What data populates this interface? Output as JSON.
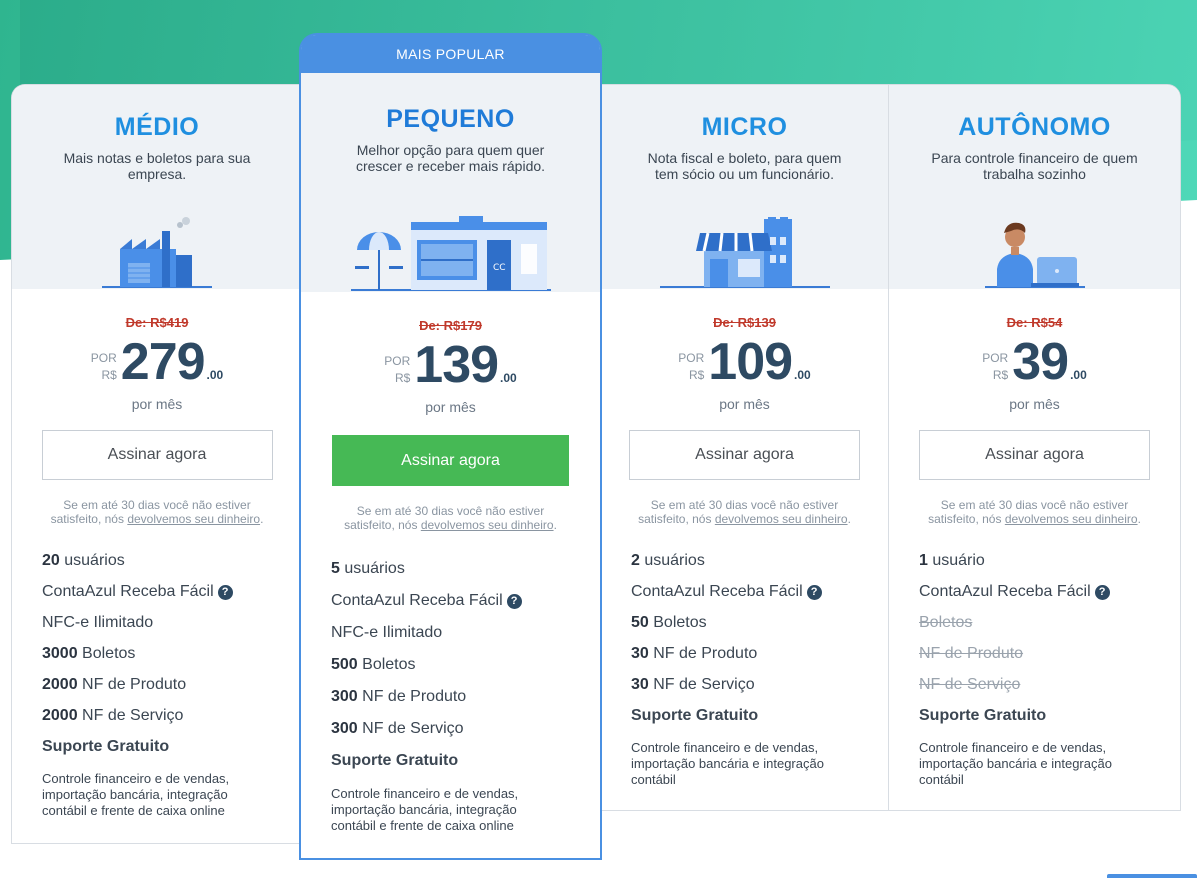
{
  "plans": [
    {
      "name": "MÉDIO",
      "desc": "Mais notas e boletos para sua empresa.",
      "old_price": "De: R$419",
      "por": "POR",
      "currency": "R$",
      "price": "279",
      "cents": ".00",
      "per_month": "por mês",
      "button": "Assinar agora",
      "guarantee_text": "Se em até 30 dias você não estiver satisfeito, nós",
      "guarantee_link": "devolvemos seu dinheiro",
      "guarantee_end": ".",
      "features": [
        {
          "num": "20",
          "text": " usuários"
        },
        {
          "num": "",
          "text": "ContaAzul Receba Fácil"
        },
        {
          "num": "",
          "text": "NFC-e Ilimitado"
        },
        {
          "num": "3000",
          "text": " Boletos"
        },
        {
          "num": "2000",
          "text": " NF de Produto"
        },
        {
          "num": "2000",
          "text": " NF de Serviço"
        },
        {
          "num": "",
          "text": "Suporte Gratuito"
        }
      ],
      "extra": "Controle financeiro e de vendas, importação bancária, integração contábil e frente de caixa online"
    },
    {
      "badge": "MAIS POPULAR",
      "name": "PEQUENO",
      "desc": "Melhor opção para quem quer crescer e receber mais rápido.",
      "old_price": "De: R$179",
      "por": "POR",
      "currency": "R$",
      "price": "139",
      "cents": ".00",
      "per_month": "por mês",
      "button": "Assinar agora",
      "guarantee_text": "Se em até 30 dias você não estiver satisfeito, nós",
      "guarantee_link": "devolvemos seu dinheiro",
      "guarantee_end": ".",
      "features": [
        {
          "num": "5",
          "text": " usuários"
        },
        {
          "num": "",
          "text": "ContaAzul Receba Fácil"
        },
        {
          "num": "",
          "text": "NFC-e Ilimitado"
        },
        {
          "num": "500",
          "text": " Boletos"
        },
        {
          "num": "300",
          "text": " NF de Produto"
        },
        {
          "num": "300",
          "text": " NF de Serviço"
        },
        {
          "num": "",
          "text": "Suporte Gratuito"
        }
      ],
      "extra": "Controle financeiro e de vendas, importação bancária, integração contábil e frente de caixa online"
    },
    {
      "name": "MICRO",
      "desc": "Nota fiscal e boleto, para quem tem sócio ou um funcionário.",
      "old_price": "De: R$139",
      "por": "POR",
      "currency": "R$",
      "price": "109",
      "cents": ".00",
      "per_month": "por mês",
      "button": "Assinar agora",
      "guarantee_text": "Se em até 30 dias você não estiver satisfeito, nós",
      "guarantee_link": "devolvemos seu dinheiro",
      "guarantee_end": ".",
      "features": [
        {
          "num": "2",
          "text": " usuários"
        },
        {
          "num": "",
          "text": "ContaAzul Receba Fácil"
        },
        {
          "num": "50",
          "text": " Boletos"
        },
        {
          "num": "30",
          "text": " NF de Produto"
        },
        {
          "num": "30",
          "text": " NF de Serviço"
        },
        {
          "num": "",
          "text": "Suporte Gratuito"
        }
      ],
      "extra": "Controle financeiro e de vendas, importação bancária e integração contábil"
    },
    {
      "name": "AUTÔNOMO",
      "desc": "Para controle financeiro de quem trabalha sozinho",
      "old_price": "De: R$54",
      "por": "POR",
      "currency": "R$",
      "price": "39",
      "cents": ".00",
      "per_month": "por mês",
      "button": "Assinar agora",
      "guarantee_text": "Se em até 30 dias você não estiver satisfeito, nós",
      "guarantee_link": "devolvemos seu dinheiro",
      "guarantee_end": ".",
      "features": [
        {
          "num": "1",
          "text": " usuário"
        },
        {
          "num": "",
          "text": "ContaAzul Receba Fácil"
        },
        {
          "num": "",
          "text": "Boletos"
        },
        {
          "num": "",
          "text": "NF de Produto"
        },
        {
          "num": "",
          "text": "NF de Serviço"
        },
        {
          "num": "",
          "text": "Suporte Gratuito"
        }
      ],
      "extra": "Controle financeiro e de vendas, importação bancária e integração contábil"
    }
  ],
  "icons": {
    "help": "question-circle-icon",
    "medio": "factory-icon",
    "pequeno": "store-with-umbrella-icon",
    "micro": "shop-awning-icon",
    "auto": "person-laptop-icon"
  },
  "colors": {
    "accent": "#1f8fe0",
    "badge": "#4a90e2",
    "primary_button": "#46b955",
    "old_price": "#c0392b",
    "price": "#2e4a63"
  }
}
